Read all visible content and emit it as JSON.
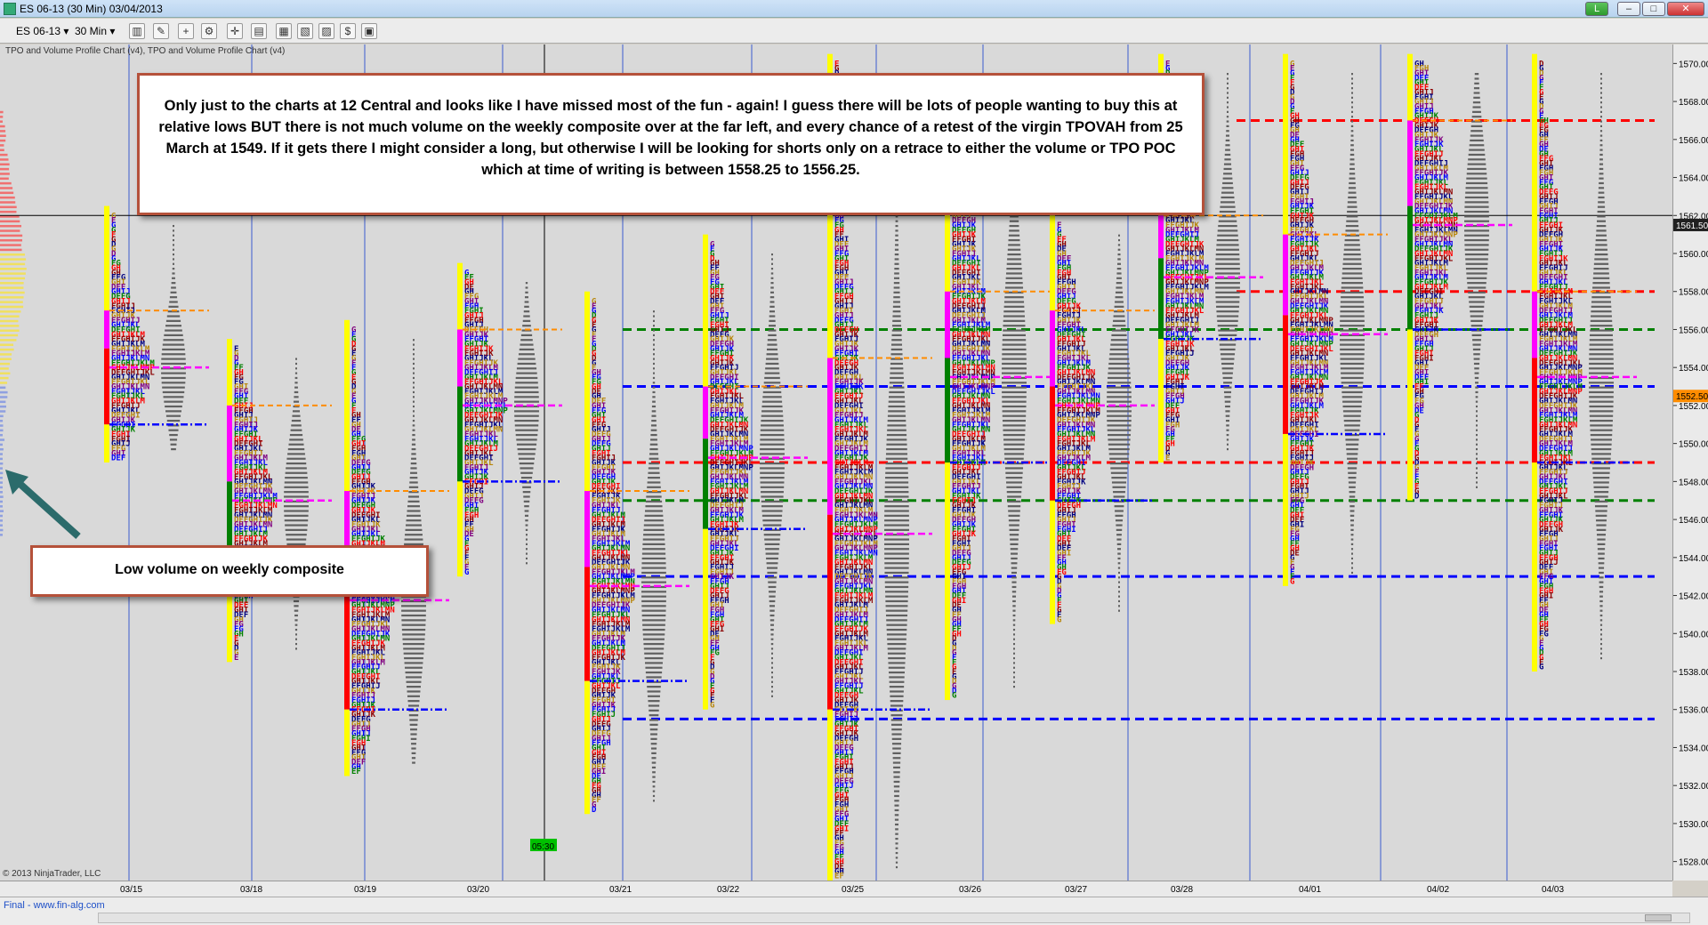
{
  "window": {
    "title": "ES 06-13 (30 Min)  03/04/2013",
    "controls": {
      "minimize": "L",
      "restore": "–",
      "maximize": "□",
      "close": "✕"
    }
  },
  "toolbar": {
    "instrument": "ES 06-13",
    "interval": "30 Min",
    "icons": [
      "bar-style-icon",
      "pen-icon",
      "add-indicator-icon",
      "properties-icon",
      "crosshair-icon",
      "data-box-icon",
      "strategy-icon",
      "chart-trader-icon",
      "properties2-icon",
      "dollar-icon",
      "save-icon"
    ]
  },
  "chart": {
    "indicator_label": "TPO and Volume Profile Chart (v4),  TPO and Volume Profile Chart (v4)",
    "copyright": "© 2013 NinjaTrader, LLC",
    "current_price": "1561.50",
    "alt_price": "1552.50",
    "time_label": "05:30"
  },
  "chart_data": {
    "type": "other",
    "description_marker": "Market profile (TPO) and volume profile chart",
    "price_range": [
      1527,
      1571
    ],
    "y_ticks": [
      "1570.00",
      "1568.00",
      "1566.00",
      "1564.00",
      "1562.00",
      "1560.00",
      "1558.00",
      "1556.00",
      "1554.00",
      "1552.00",
      "1550.00",
      "1548.00",
      "1546.00",
      "1544.00",
      "1542.00",
      "1540.00",
      "1538.00",
      "1536.00",
      "1534.00",
      "1532.00",
      "1530.00",
      "1528.00"
    ],
    "x_ticks": [
      "03/15",
      "03/18",
      "03/19",
      "03/20",
      "03/21",
      "03/22",
      "03/25",
      "03/26",
      "03/27",
      "03/28",
      "04/01",
      "04/02",
      "04/03"
    ],
    "sessions": [
      {
        "date": "03/15",
        "low": 1549.0,
        "high": 1562.5,
        "value_area_low": 1551.0,
        "value_area_high": 1557.0
      },
      {
        "date": "03/18",
        "low": 1538.5,
        "high": 1555.5,
        "value_area_low": 1542.0,
        "value_area_high": 1552.0
      },
      {
        "date": "03/19",
        "low": 1532.5,
        "high": 1556.5,
        "value_area_low": 1536.0,
        "value_area_high": 1547.5
      },
      {
        "date": "03/20",
        "low": 1543.0,
        "high": 1559.5,
        "value_area_low": 1548.0,
        "value_area_high": 1556.0
      },
      {
        "date": "03/21",
        "low": 1530.5,
        "high": 1558.0,
        "value_area_low": 1537.5,
        "value_area_high": 1547.5
      },
      {
        "date": "03/22",
        "low": 1536.0,
        "high": 1561.0,
        "value_area_low": 1545.5,
        "value_area_high": 1553.0
      },
      {
        "date": "03/25",
        "low": 1527.0,
        "high": 1570.5,
        "value_area_low": 1536.0,
        "value_area_high": 1554.5
      },
      {
        "date": "03/26",
        "low": 1536.5,
        "high": 1569.5,
        "value_area_low": 1549.0,
        "value_area_high": 1558.0
      },
      {
        "date": "03/27",
        "low": 1540.5,
        "high": 1562.0,
        "value_area_low": 1547.0,
        "value_area_high": 1557.0
      },
      {
        "date": "03/28",
        "low": 1549.0,
        "high": 1570.5,
        "value_area_low": 1555.5,
        "value_area_high": 1562.0
      },
      {
        "date": "04/01",
        "low": 1542.5,
        "high": 1570.5,
        "value_area_low": 1550.5,
        "value_area_high": 1561.0
      },
      {
        "date": "04/02",
        "low": 1547.0,
        "high": 1570.5,
        "value_area_low": 1556.0,
        "value_area_high": 1567.0
      },
      {
        "date": "04/03",
        "low": 1538.0,
        "high": 1570.5,
        "value_area_low": 1549.0,
        "value_area_high": 1558.0
      }
    ],
    "horizontal_levels": [
      {
        "price": 1567.0,
        "color": "#ff0000"
      },
      {
        "price": 1562.0,
        "color": "#000000"
      },
      {
        "price": 1558.0,
        "color": "#ff0000"
      },
      {
        "price": 1556.0,
        "color": "#008000"
      },
      {
        "price": 1553.0,
        "color": "#0000ff"
      },
      {
        "price": 1549.0,
        "color": "#ff0000"
      },
      {
        "price": 1547.0,
        "color": "#008000"
      },
      {
        "price": 1543.0,
        "color": "#0000ff"
      },
      {
        "price": 1535.5,
        "color": "#0000ff"
      }
    ]
  },
  "annotations": {
    "main": "Only just to the charts at 12 Central and looks like I have missed most of the fun - again!  I guess there will be lots of people wanting to buy this at relative lows BUT there is not much volume on the weekly composite over at the far left, and every chance of a retest of the virgin TPOVAH from 25 March at 1549.  If it gets there I might consider a long, but otherwise I will be looking for shorts only on a retrace to either the volume or TPO POC which at time of writing is between 1558.25 to 1556.25.",
    "composite": "Low volume on weekly composite"
  },
  "footer": {
    "text": "Final - www.fin-alg.com"
  },
  "colors": {
    "red": "#ff0000",
    "green": "#008000",
    "blue": "#0000ff",
    "magenta": "#ff00ff",
    "yellow": "#ffff00",
    "orange": "#ff8c00",
    "gray": "#606060",
    "callout_border": "#b5513a"
  }
}
